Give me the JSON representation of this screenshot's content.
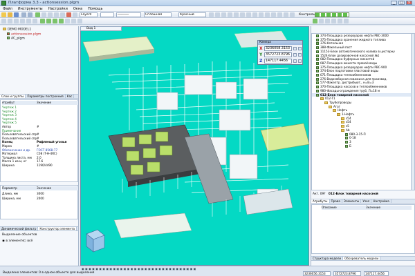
{
  "window": {
    "title": "Платформа 3.3 - actionsession.plgm"
  },
  "menu": [
    "Файл",
    "Инструменты",
    "Настройки",
    "Окна",
    "Помощь"
  ],
  "toolbar2": {
    "layer_field": "Layer0",
    "style_field": "Сплошная",
    "color_field": "Красный",
    "right_label": "Контроль"
  },
  "left": {
    "tree": [
      {
        "label": "DEMO MODEL1",
        "color": "#000"
      },
      {
        "label": "actionsession.plgm",
        "color": "#c01818"
      },
      {
        "label": "AC_plgm",
        "color": "#000"
      }
    ],
    "tabs_top": [
      "Слои и группы",
      "Параметры построения",
      "Кас"
    ],
    "prop_header": {
      "k": "Атрибут",
      "v": "Значение"
    },
    "props": [
      {
        "k": "Чертеж 1",
        "v": "",
        "cls": "green"
      },
      {
        "k": "Чертеж 2",
        "v": "",
        "cls": "green"
      },
      {
        "k": "Чертеж 3",
        "v": "",
        "cls": "green"
      },
      {
        "k": "Чертеж 4",
        "v": "",
        "cls": "green"
      },
      {
        "k": "Чертеж 5",
        "v": "",
        "cls": "green"
      },
      {
        "k": "Автор",
        "v": "#",
        "cls": ""
      },
      {
        "k": "Примечание",
        "v": "",
        "cls": "green"
      },
      {
        "k": "Пользовательский справочник",
        "v": "#",
        "cls": ""
      },
      {
        "k": "Пользовательский справочник",
        "v": "#",
        "cls": ""
      },
      {
        "k": "Конец",
        "v": "Рифленый угольн",
        "cls": "bold"
      },
      {
        "k": "Марка",
        "v": "#",
        "cls": ""
      },
      {
        "k": "Обозначение и др.",
        "v": "ГОСТ 8568-77",
        "cls": "blue"
      },
      {
        "k": "Материал",
        "v": "C08 (T-H-4RC)",
        "cls": ""
      },
      {
        "k": "Толщина листа, мм",
        "v": "2.0",
        "cls": ""
      },
      {
        "k": "Масса 1 кв.м, кг",
        "v": "17.6",
        "cls": ""
      },
      {
        "k": "Ширина",
        "v": "1190/4490",
        "cls": ""
      }
    ],
    "param_header": {
      "k": "Параметр",
      "v": "Значение"
    },
    "params": [
      {
        "k": "Длина, мм",
        "v": "3000"
      },
      {
        "k": "Ширина, мм",
        "v": "2000"
      }
    ],
    "tabs_bottom": [
      "Динамический фильтр",
      "Конструктор элемента"
    ],
    "bottom_title": "Выделение объектов",
    "radio1": "в элементе",
    "radio2": "всё"
  },
  "viewport": {
    "tab": "Вид 1"
  },
  "coords": {
    "title": "Камера",
    "x": "3236058.3153",
    "y": "3572723.8796",
    "z": "147117.4456"
  },
  "right": {
    "items": [
      {
        "label": "374-Площадка резервуаров нефти РВС-3000",
        "kind": "node",
        "indent": 6
      },
      {
        "label": "375-Площадка хранения жидкого топлива",
        "kind": "node",
        "indent": 6
      },
      {
        "label": "376-Котельная",
        "kind": "node",
        "indent": 6
      },
      {
        "label": "388-Факельный пост",
        "kind": "node",
        "indent": 6
      },
      {
        "label": "11153-Блок автоматического налива в цистерну",
        "kind": "node",
        "indent": 6
      },
      {
        "label": "1524-Блок дозировочной насосной №1",
        "kind": "node",
        "indent": 6
      },
      {
        "label": "082-Площадка буферных емкостей",
        "kind": "node",
        "indent": 6
      },
      {
        "label": "087-Площадка емкости прямой воды",
        "kind": "node",
        "indent": 6
      },
      {
        "label": "375-Площадка резервуаров нефти РВС-900",
        "kind": "node",
        "indent": 6
      },
      {
        "label": "374-Блок подготовки пластовой воды",
        "kind": "node",
        "indent": 6
      },
      {
        "label": "071-Площадка теплообменников",
        "kind": "node",
        "indent": 6
      },
      {
        "label": "276-Водозаборная скважина для производ.",
        "kind": "node",
        "indent": 6
      },
      {
        "label": "577-Факелтр. дистрибьют., н=В=3",
        "kind": "node",
        "indent": 6
      },
      {
        "label": "370-Площадка насосов и теплообменников",
        "kind": "node",
        "indent": 6
      },
      {
        "label": "980-Фасады-ограждения труб, Л=18 м",
        "kind": "node",
        "indent": 6
      },
      {
        "label": "012-Блок товарной насосной",
        "kind": "node",
        "indent": 6,
        "bold": true
      },
      {
        "label": "012-Т1",
        "kind": "folder",
        "indent": 12
      },
      {
        "label": "Трубопроводы",
        "kind": "folder",
        "indent": 18
      },
      {
        "label": "Агат",
        "kind": "folder",
        "indent": 24
      },
      {
        "label": "Нефть",
        "kind": "folder",
        "indent": 30
      },
      {
        "label": "1-Нефть",
        "kind": "folder",
        "indent": 36
      },
      {
        "label": "s54",
        "kind": "folder",
        "indent": 42
      },
      {
        "label": "s54",
        "kind": "folder",
        "indent": 42
      },
      {
        "label": "s5",
        "kind": "folder",
        "indent": 42
      },
      {
        "label": "Ab",
        "kind": "folder",
        "indent": 42
      },
      {
        "label": "080-3-15-П",
        "kind": "node",
        "indent": 48
      },
      {
        "label": "0-18",
        "kind": "node",
        "indent": 48
      },
      {
        "label": "3",
        "kind": "node",
        "indent": 48
      },
      {
        "label": "Б",
        "kind": "node",
        "indent": 48
      }
    ],
    "act_label": "Акт. 09?",
    "act_value": "012-Блок товарной насосной",
    "tabs": [
      "Атрибуты",
      "Права",
      "Элементы",
      "Узел",
      "Настройка"
    ],
    "table_header": {
      "k": "Описание",
      "v": "Значение"
    },
    "bottom_tabs": [
      "Структура модели",
      "Обозреватель модели"
    ]
  },
  "status": {
    "message": "Выделено элементов: 0 в одном объекте для выделения",
    "f1": "3236056.3153",
    "f2": "3572723.8796",
    "f3": "147117.4456"
  }
}
